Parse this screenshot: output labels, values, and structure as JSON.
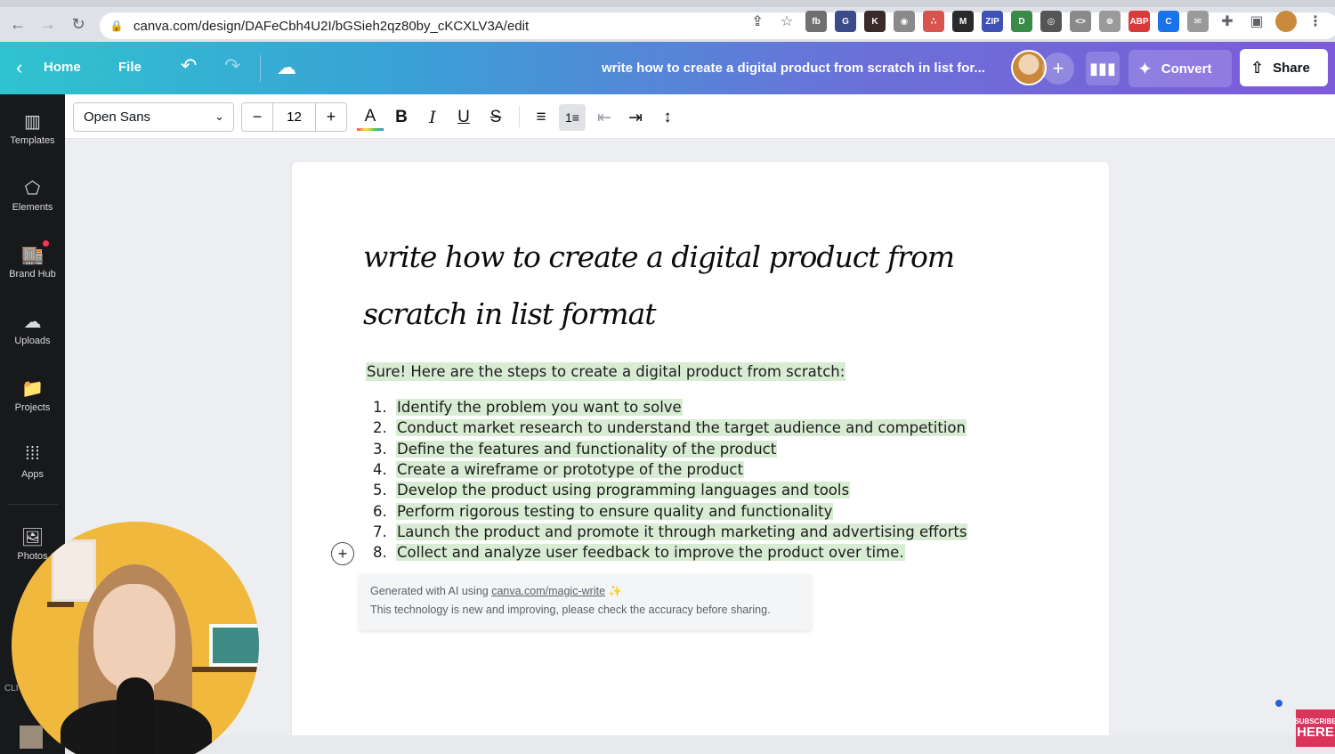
{
  "browser": {
    "url": "canva.com/design/DAFeCbh4U2I/bGSieh2qz80by_cKCXLV3A/edit",
    "extensions": [
      {
        "name": "share-icon",
        "color": "#5f6368",
        "glyph": "⇪"
      },
      {
        "name": "star-icon",
        "color": "#5f6368",
        "glyph": "☆"
      },
      {
        "name": "ext-icon-1",
        "color": "#6f6f6f",
        "glyph": "fb"
      },
      {
        "name": "ext-icon-2",
        "color": "#3a4a8a",
        "glyph": "G"
      },
      {
        "name": "ext-icon-3",
        "color": "#3a2a2a",
        "glyph": "K"
      },
      {
        "name": "camera-icon",
        "color": "#8a8a8a",
        "glyph": "◉"
      },
      {
        "name": "ext-icon-4",
        "color": "#d9534f",
        "glyph": "∴"
      },
      {
        "name": "ext-icon-5",
        "color": "#2a2a2a",
        "glyph": "M"
      },
      {
        "name": "zip-icon",
        "color": "#3f51b5",
        "glyph": "ZIP"
      },
      {
        "name": "ext-icon-6",
        "color": "#3a8a4a",
        "glyph": "D"
      },
      {
        "name": "ext-icon-7",
        "color": "#555",
        "glyph": "◎"
      },
      {
        "name": "code-icon",
        "color": "#8a8a8a",
        "glyph": "<>"
      },
      {
        "name": "ext-icon-8",
        "color": "#9a9a9a",
        "glyph": "⊛"
      },
      {
        "name": "abp-icon",
        "color": "#d93a3a",
        "glyph": "ABP"
      },
      {
        "name": "ext-icon-9",
        "color": "#1a73e8",
        "glyph": "C"
      },
      {
        "name": "mail-icon",
        "color": "#9a9a9a",
        "glyph": "✉"
      },
      {
        "name": "puzzle-icon",
        "color": "#5f6368",
        "glyph": "✚"
      },
      {
        "name": "sidepanel-icon",
        "color": "#5f6368",
        "glyph": "▣"
      },
      {
        "name": "profile-avatar",
        "color": "#c98a3d",
        "glyph": ""
      },
      {
        "name": "menu-dots-icon",
        "color": "#5f6368",
        "glyph": "⋮"
      }
    ]
  },
  "header": {
    "home_label": "Home",
    "file_label": "File",
    "title": "write how to create a digital product from scratch in list for...",
    "convert_label": "Convert",
    "share_label": "Share"
  },
  "sidebar": {
    "items": [
      {
        "label": "Templates",
        "icon": "▥"
      },
      {
        "label": "Elements",
        "icon": "⬠"
      },
      {
        "label": "Brand Hub",
        "icon": "🏬"
      },
      {
        "label": "Uploads",
        "icon": "☁"
      },
      {
        "label": "Projects",
        "icon": "📁"
      },
      {
        "label": "Apps",
        "icon": "⁞⁞⁞"
      },
      {
        "label": "Photos",
        "icon": "🖼"
      }
    ],
    "cli_label": "CLI"
  },
  "toolbar": {
    "font": "Open Sans",
    "size": "12"
  },
  "doc": {
    "title": "write how to create a digital product from scratch in list format",
    "intro": "Sure! Here are the steps to create a digital product from scratch:",
    "steps": [
      {
        "num": "1.",
        "text": "Identify the problem you want to solve"
      },
      {
        "num": "2.",
        "text": "Conduct market research to understand the target audience and competition"
      },
      {
        "num": "3.",
        "text": "Define the features and functionality of the product"
      },
      {
        "num": "4.",
        "text": "Create a wireframe or prototype of the product"
      },
      {
        "num": "5.",
        "text": "Develop the product using programming languages and tools"
      },
      {
        "num": "6.",
        "text": "Perform rigorous testing to ensure quality and functionality"
      },
      {
        "num": "7.",
        "text": "Launch the product and promote it through marketing and advertising efforts"
      },
      {
        "num": "8.",
        "text": "Collect and analyze user feedback to improve the product over time."
      }
    ]
  },
  "ai_note": {
    "line1_prefix": "Generated with AI using ",
    "link": "canva.com/magic-write",
    "line2": "This technology is new and improving, please check the accuracy before sharing."
  },
  "overlay": {
    "subscribe_top": "SUBSCRIBE",
    "subscribe_bottom": "HERE"
  }
}
